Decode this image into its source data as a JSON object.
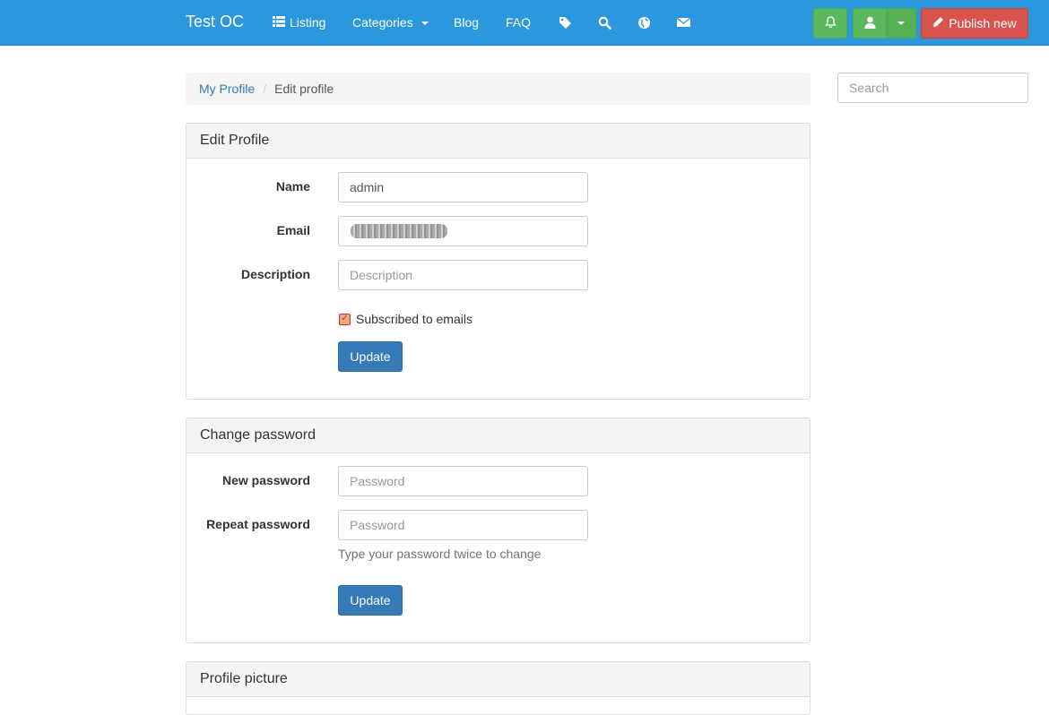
{
  "navbar": {
    "brand": "Test OC",
    "items": [
      {
        "label": "Listing",
        "icon": "list-icon"
      },
      {
        "label": "Categories",
        "icon": "caret-down-icon"
      },
      {
        "label": "Blog"
      },
      {
        "label": "FAQ"
      }
    ],
    "icons": [
      "tag-icon",
      "search-icon",
      "globe-icon",
      "envelope-icon"
    ],
    "publish_label": "Publish new",
    "colors": {
      "navbar": "#2b98de",
      "success": "#5cb85c",
      "danger": "#d9534f",
      "primary": "#337ab7"
    }
  },
  "breadcrumb": {
    "link": "My Profile",
    "separator": "/",
    "active": "Edit profile"
  },
  "search": {
    "placeholder": "Search"
  },
  "edit_profile": {
    "title": "Edit Profile",
    "name_label": "Name",
    "name_value": "admin",
    "email_label": "Email",
    "email_value": "",
    "description_label": "Description",
    "description_placeholder": "Description",
    "subscribed_label": "Subscribed to emails",
    "subscribed_checked": true,
    "update_label": "Update"
  },
  "change_password": {
    "title": "Change password",
    "new_label": "New password",
    "new_placeholder": "Password",
    "repeat_label": "Repeat password",
    "repeat_placeholder": "Password",
    "help": "Type your password twice to change",
    "update_label": "Update"
  },
  "profile_picture": {
    "title": "Profile picture"
  }
}
